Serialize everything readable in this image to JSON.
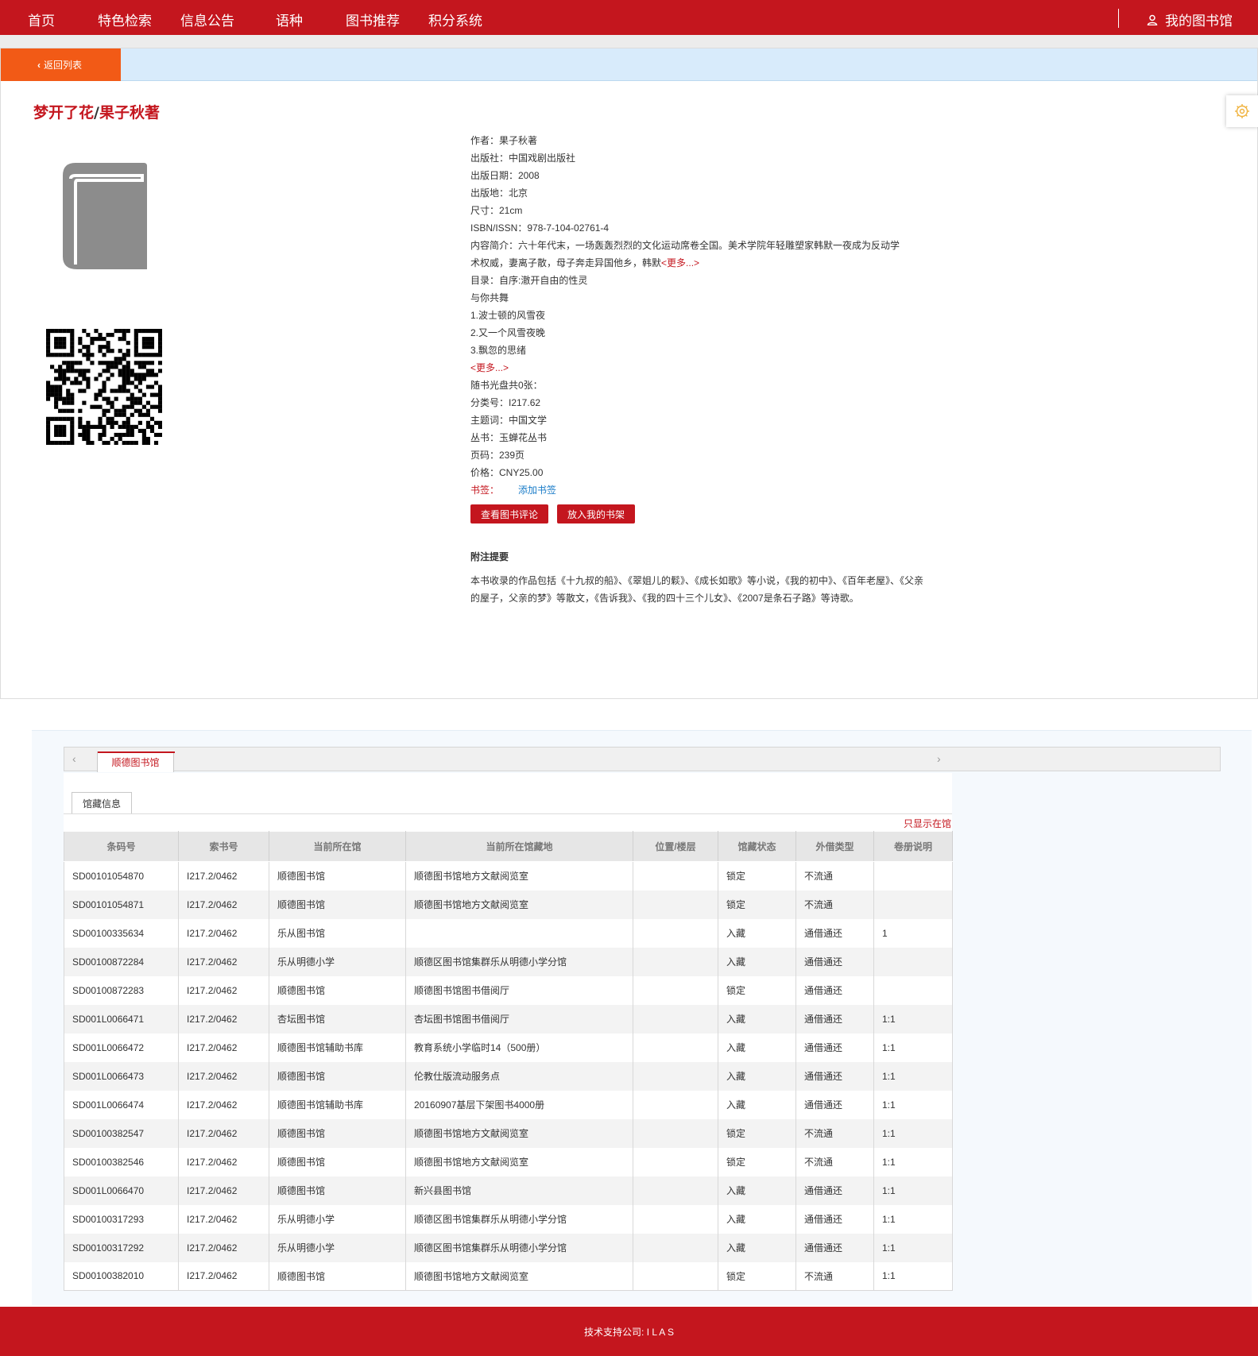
{
  "nav": {
    "items": [
      "首页",
      "特色检索",
      "信息公告",
      "语种",
      "图书推荐",
      "积分系统"
    ],
    "my_library": "我的图书馆"
  },
  "back_label": "返回列表",
  "book": {
    "title_main": "梦开了花",
    "title_sep": "/",
    "title_author": "果子秋著",
    "fields": {
      "author": "作者：果子秋著",
      "publisher": "出版社：中国戏剧出版社",
      "date": "出版日期：2008",
      "place": "出版地：北京",
      "size": "尺寸：21cm",
      "isbn": "ISBN/ISSN：978-7-104-02761-4",
      "summary1": "内容简介：六十年代末，一场轰轰烈烈的文化运动席卷全国。美术学院年轻雕塑家韩默一夜成为反动学",
      "summary2": "术权威，妻离子散，母子奔走异国他乡，韩默",
      "more": "<更多...>",
      "toc": "目录：自序:澈开自由的性灵",
      "toc1": "与你共舞",
      "toc2": "1.波士顿的风雪夜",
      "toc3": "2.又一个风雪夜晚",
      "toc4": "3.飘忽的思绪",
      "toc_more": "<更多...>",
      "cd": "随书光盘共0张：",
      "classno": "分类号：I217.62",
      "subject": "主题词：中国文学",
      "series": "丛书：玉蝉花丛书",
      "pages": "页码：239页",
      "price": "价格：CNY25.00",
      "bookmark_label": "书签：",
      "bookmark_add": "添加书签"
    },
    "btn_review": "查看图书评论",
    "btn_shelf": "放入我的书架",
    "annotation_title": "附注提要",
    "annotation_line1": "本书收录的作品包括《十九叔的船》、《翠姐儿的鬏》、《成长如歌》等小说，《我的初中》、《百年老屋》、《父亲",
    "annotation_line2": "的屋子，父亲的梦》等散文，《告诉我》、《我的四十三个儿女》、《2007是条石子路》等诗歌。"
  },
  "holdings": {
    "library_tab": "顺德图书馆",
    "sub_tab": "馆藏信息",
    "only_in_library": "只显示在馆",
    "columns": [
      "条码号",
      "索书号",
      "当前所在馆",
      "当前所在馆藏地",
      "位置/楼层",
      "馆藏状态",
      "外借类型",
      "卷册说明"
    ],
    "rows": [
      [
        "SD00101054870",
        "I217.2/0462",
        "顺德图书馆",
        "顺德图书馆地方文献阅览室",
        "",
        "锁定",
        "不流通",
        ""
      ],
      [
        "SD00101054871",
        "I217.2/0462",
        "顺德图书馆",
        "顺德图书馆地方文献阅览室",
        "",
        "锁定",
        "不流通",
        ""
      ],
      [
        "SD00100335634",
        "I217.2/0462",
        "乐从图书馆",
        "",
        "",
        "入藏",
        "通借通还",
        "1"
      ],
      [
        "SD00100872284",
        "I217.2/0462",
        "乐从明德小学",
        "顺德区图书馆集群乐从明德小学分馆",
        "",
        "入藏",
        "通借通还",
        ""
      ],
      [
        "SD00100872283",
        "I217.2/0462",
        "顺德图书馆",
        "顺德图书馆图书借阅厅",
        "",
        "锁定",
        "通借通还",
        ""
      ],
      [
        "SD001L0066471",
        "I217.2/0462",
        "杏坛图书馆",
        "杏坛图书馆图书借阅厅",
        "",
        "入藏",
        "通借通还",
        "1:1"
      ],
      [
        "SD001L0066472",
        "I217.2/0462",
        "顺德图书馆辅助书库",
        "教育系统小学临时14（500册）",
        "",
        "入藏",
        "通借通还",
        "1:1"
      ],
      [
        "SD001L0066473",
        "I217.2/0462",
        "顺德图书馆",
        "伦教仕版流动服务点",
        "",
        "入藏",
        "通借通还",
        "1:1"
      ],
      [
        "SD001L0066474",
        "I217.2/0462",
        "顺德图书馆辅助书库",
        "20160907基层下架图书4000册",
        "",
        "入藏",
        "通借通还",
        "1:1"
      ],
      [
        "SD00100382547",
        "I217.2/0462",
        "顺德图书馆",
        "顺德图书馆地方文献阅览室",
        "",
        "锁定",
        "不流通",
        "1:1"
      ],
      [
        "SD00100382546",
        "I217.2/0462",
        "顺德图书馆",
        "顺德图书馆地方文献阅览室",
        "",
        "锁定",
        "不流通",
        "1:1"
      ],
      [
        "SD001L0066470",
        "I217.2/0462",
        "顺德图书馆",
        "新兴县图书馆",
        "",
        "入藏",
        "通借通还",
        "1:1"
      ],
      [
        "SD00100317293",
        "I217.2/0462",
        "乐从明德小学",
        "顺德区图书馆集群乐从明德小学分馆",
        "",
        "入藏",
        "通借通还",
        "1:1"
      ],
      [
        "SD00100317292",
        "I217.2/0462",
        "乐从明德小学",
        "顺德区图书馆集群乐从明德小学分馆",
        "",
        "入藏",
        "通借通还",
        "1:1"
      ],
      [
        "SD00100382010",
        "I217.2/0462",
        "顺德图书馆",
        "顺德图书馆地方文献阅览室",
        "",
        "锁定",
        "不流通",
        "1:1"
      ]
    ]
  },
  "footer": "技术支持公司: I L A S",
  "colors": {
    "brand_red": "#c4161e",
    "back_orange": "#f25a16",
    "back_bar": "#d8ebfb"
  }
}
